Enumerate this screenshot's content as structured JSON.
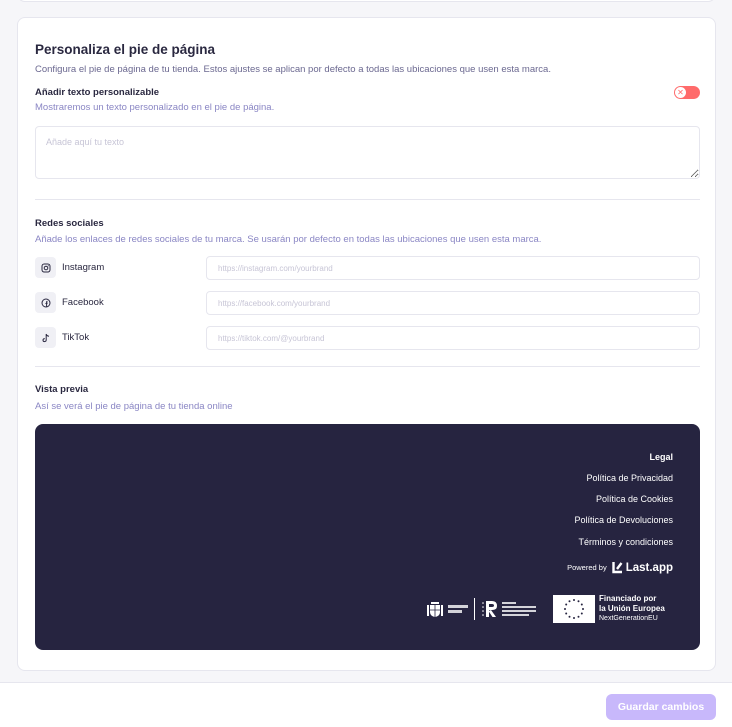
{
  "section": {
    "title": "Personaliza el pie de página",
    "description": "Configura el pie de página de tu tienda. Estos ajustes se aplican por defecto a todas las ubicaciones que usen esta marca."
  },
  "custom_text": {
    "label": "Añadir texto personalizable",
    "description": "Mostraremos un texto personalizado en el pie de página.",
    "placeholder": "Añade aquí tu texto",
    "value": "",
    "toggle_enabled": false,
    "toggle_color": "#ff6b6b"
  },
  "social": {
    "title": "Redes sociales",
    "description": "Añade los enlaces de redes sociales de tu marca. Se usarán por defecto en todas las ubicaciones que usen esta marca.",
    "networks": [
      {
        "name": "Instagram",
        "icon": "instagram-icon",
        "placeholder": "https://instagram.com/yourbrand",
        "value": ""
      },
      {
        "name": "Facebook",
        "icon": "facebook-icon",
        "placeholder": "https://facebook.com/yourbrand",
        "value": ""
      },
      {
        "name": "TikTok",
        "icon": "tiktok-icon",
        "placeholder": "https://tiktok.com/@yourbrand",
        "value": ""
      }
    ]
  },
  "preview": {
    "title": "Vista previa",
    "description": "Así se verá el pie de página de tu tienda online",
    "background": "#262440",
    "legal_heading": "Legal",
    "legal_links": [
      "Política de Privacidad",
      "Política de Cookies",
      "Política de Devoluciones",
      "Términos y condiciones"
    ],
    "powered_by": "Powered by",
    "brand_name": "Last.app",
    "eu_line1": "Financiado por",
    "eu_line2": "la Unión Europea",
    "eu_line3": "NextGenerationEU"
  },
  "actions": {
    "save_label": "Guardar cambios",
    "save_color": "#c8b8fb"
  }
}
